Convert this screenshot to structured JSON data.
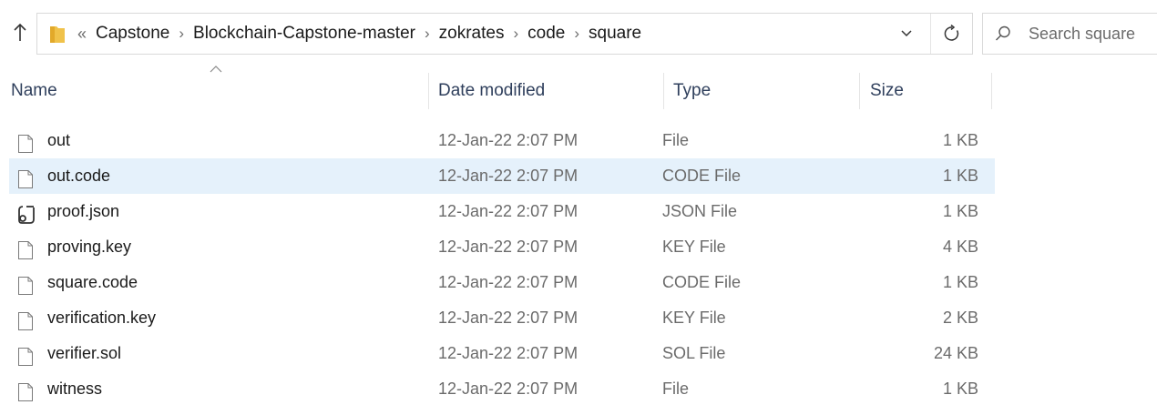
{
  "address": {
    "overflow": "«",
    "crumbs": [
      "Capstone",
      "Blockchain-Capstone-master",
      "zokrates",
      "code",
      "square"
    ],
    "separator": "›"
  },
  "search": {
    "placeholder": "Search square"
  },
  "columns": {
    "name": "Name",
    "date": "Date modified",
    "type": "Type",
    "size": "Size"
  },
  "files": [
    {
      "name": "out",
      "date": "12-Jan-22 2:07 PM",
      "type": "File",
      "size": "1 KB",
      "icon": "file-icon"
    },
    {
      "name": "out.code",
      "date": "12-Jan-22 2:07 PM",
      "type": "CODE File",
      "size": "1 KB",
      "icon": "file-icon",
      "selected": true
    },
    {
      "name": "proof.json",
      "date": "12-Jan-22 2:07 PM",
      "type": "JSON File",
      "size": "1 KB",
      "icon": "json-script-icon"
    },
    {
      "name": "proving.key",
      "date": "12-Jan-22 2:07 PM",
      "type": "KEY File",
      "size": "4 KB",
      "icon": "file-icon"
    },
    {
      "name": "square.code",
      "date": "12-Jan-22 2:07 PM",
      "type": "CODE File",
      "size": "1 KB",
      "icon": "file-icon"
    },
    {
      "name": "verification.key",
      "date": "12-Jan-22 2:07 PM",
      "type": "KEY File",
      "size": "2 KB",
      "icon": "file-icon"
    },
    {
      "name": "verifier.sol",
      "date": "12-Jan-22 2:07 PM",
      "type": "SOL File",
      "size": "24 KB",
      "icon": "file-icon"
    },
    {
      "name": "witness",
      "date": "12-Jan-22 2:07 PM",
      "type": "File",
      "size": "1 KB",
      "icon": "file-icon"
    }
  ],
  "colors": {
    "selection": "#e5f1fb",
    "folder": "#f0c24a",
    "header_text": "#2f3f5c",
    "secondary_text": "#6b6b6b"
  }
}
